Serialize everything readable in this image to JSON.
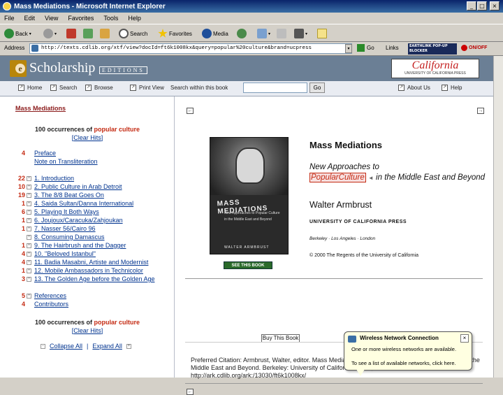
{
  "window": {
    "title": "Mass Mediations - Microsoft Internet Explorer",
    "min_label": "_",
    "max_label": "□",
    "close_label": "×"
  },
  "menu": [
    "File",
    "Edit",
    "View",
    "Favorites",
    "Tools",
    "Help"
  ],
  "toolbar": {
    "back": "Back",
    "search": "Search",
    "favorites": "Favorites",
    "media": "Media"
  },
  "address": {
    "label": "Address",
    "url": "http://texts.cdlib.org/xtf/view?docId=ft6k1008kx&query=popular%20culture&brand=ucpress",
    "go": "Go",
    "links": "Links",
    "earthlink": "EARTHLINK POP-UP BLOCKER",
    "onoff": "ON/OFF"
  },
  "banner": {
    "logo_letter": "e",
    "logo_text": "Scholarship",
    "logo_sub": "EDITIONS",
    "ucpress_main": "California",
    "ucpress_sub": "UNIVERSITY OF CALIFORNIA PRESS"
  },
  "nav": {
    "home": "Home",
    "search": "Search",
    "browse": "Browse",
    "print": "Print View",
    "search_within": "Search within this book",
    "go": "Go",
    "about": "About Us",
    "help": "Help"
  },
  "toc": {
    "book_title": "Mass Mediations",
    "occ_count": "100 occurrences of",
    "occ_term": "popular culture",
    "clear_hits": "Clear Hits",
    "rows": [
      {
        "count": "4",
        "label": "Preface",
        "link": true,
        "exp": false
      },
      {
        "count": "",
        "label": "Note on Transliteration",
        "link": true,
        "exp": false
      },
      {
        "count": "22",
        "label": "1. Introduction",
        "link": true,
        "exp": true
      },
      {
        "count": "10",
        "label": "2. Public Culture in Arab Detroit",
        "link": true,
        "exp": true
      },
      {
        "count": "19",
        "label": "3. The 8/8 Beat Goes On",
        "link": true,
        "exp": true
      },
      {
        "count": "1",
        "label": "4. Saida Sultan/Danna International",
        "link": true,
        "exp": true
      },
      {
        "count": "6",
        "label": "5. Playing It Both Ways",
        "link": true,
        "exp": true
      },
      {
        "count": "1",
        "label": "6. Joujoux/Caracuka/Zahjoukan",
        "link": true,
        "exp": true
      },
      {
        "count": "1",
        "label": "7. Nasser 56/Cairo 96",
        "link": true,
        "exp": true
      },
      {
        "count": "",
        "label": "8. Consuming Damascus",
        "link": true,
        "exp": true
      },
      {
        "count": "1",
        "label": "9. The Hairbrush and the Dagger",
        "link": true,
        "exp": true
      },
      {
        "count": "4",
        "label": "10. \"Beloved Istanbul\"",
        "link": true,
        "exp": true
      },
      {
        "count": "4",
        "label": "11. Badia Masabni, Artiste and Modernist",
        "link": true,
        "exp": true
      },
      {
        "count": "1",
        "label": "12. Mobile Ambassadors in Technicolor",
        "link": true,
        "exp": true
      },
      {
        "count": "3",
        "label": "13. The Golden Age before the Golden Age",
        "link": true,
        "exp": true
      },
      {
        "count": "5",
        "label": "References",
        "link": true,
        "exp": true
      },
      {
        "count": "4",
        "label": "Contributors",
        "link": true,
        "exp": false
      }
    ],
    "collapse_all": "Collapse All",
    "expand_all": "Expand All"
  },
  "content": {
    "cover_title": "MASS MEDIATIONS",
    "cover_sub": "New Approaches to Popular Culture in the Middle East and Beyond",
    "cover_author": "WALTER ARMBRUST",
    "see_book": "SEE THIS BOOK",
    "book_title": "Mass Mediations",
    "subtitle_pre": "New Approaches to",
    "subtitle_hl": "PopularCulture",
    "subtitle_post": "in the Middle East and Beyond",
    "author": "Walter Armbrust",
    "press": "UNIVERSITY OF CALIFORNIA PRESS",
    "place": "Berkeley · Los Angeles · London",
    "copyright": "© 2000 The Regents of the University of California",
    "buy": "Buy This Book",
    "citation": "Preferred Citation: Armbrust, Walter, editor. Mass Mediations: New Approaches to Popular Culture in the Middle East and Beyond. Berkeley: University of California Press, c2000 2000. http://ark.cdlib.org/ark:/13030/ft6k1008kx/"
  },
  "balloon": {
    "title": "Wireless Network Connection",
    "msg1": "One or more wireless networks are available.",
    "msg2": "To see a list of available networks, click here.",
    "close": "×"
  }
}
